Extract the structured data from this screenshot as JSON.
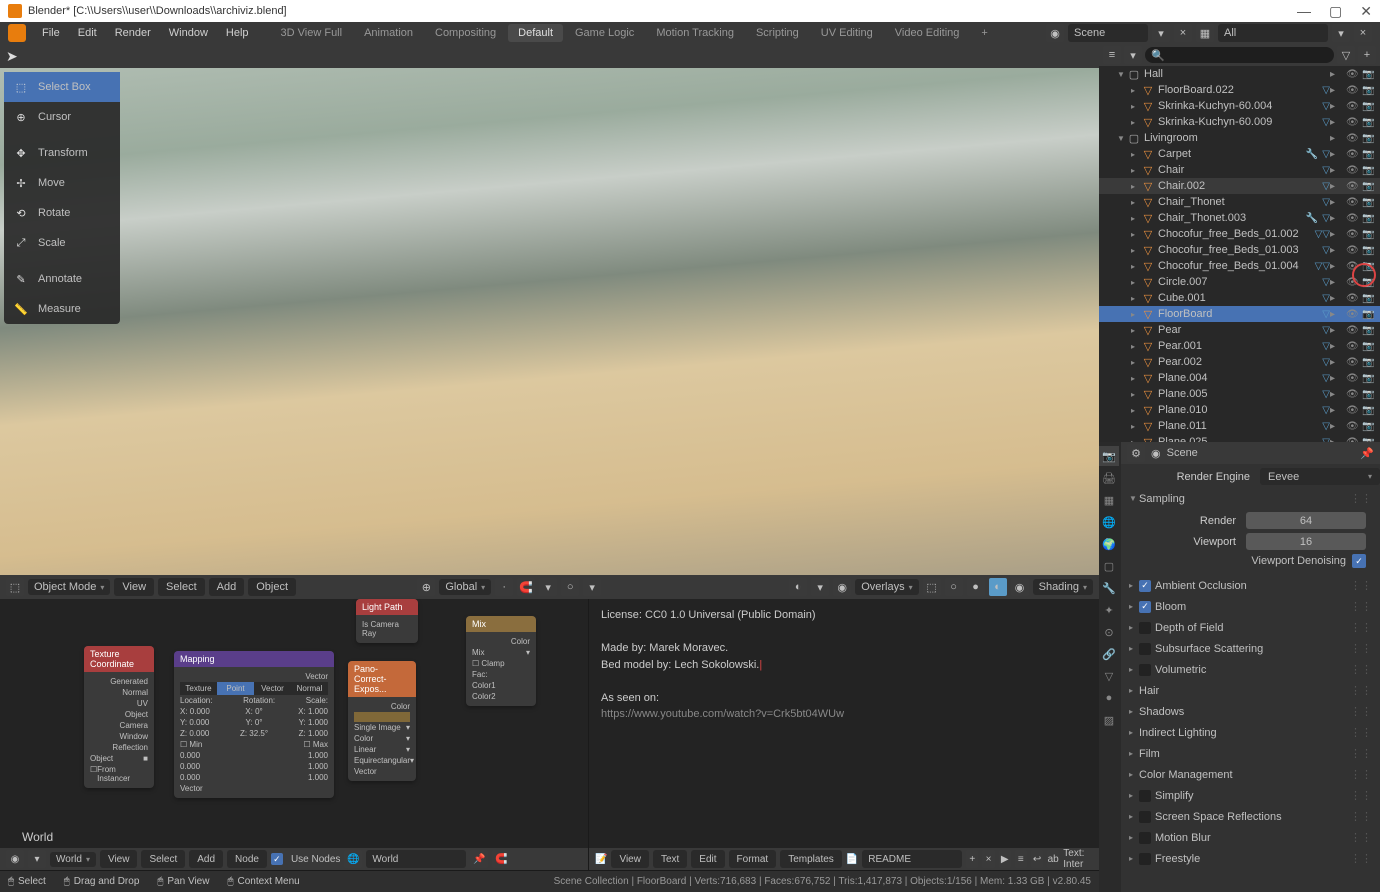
{
  "titlebar": {
    "title": "Blender* [C:\\\\Users\\\\user\\\\Downloads\\\\archiviz.blend]"
  },
  "menubar": {
    "items": [
      "File",
      "Edit",
      "Render",
      "Window",
      "Help"
    ],
    "workspaces": [
      "3D View Full",
      "Animation",
      "Compositing",
      "Default",
      "Game Logic",
      "Motion Tracking",
      "Scripting",
      "UV Editing",
      "Video Editing"
    ],
    "active_workspace": "Default",
    "scene": "Scene",
    "layers": "All"
  },
  "tools": [
    {
      "label": "Select Box",
      "active": true,
      "icon": "⬚"
    },
    {
      "label": "Cursor",
      "icon": "⊕"
    },
    {
      "label": "Transform",
      "icon": "✥",
      "sep_before": true
    },
    {
      "label": "Move",
      "icon": "✢"
    },
    {
      "label": "Rotate",
      "icon": "⟲"
    },
    {
      "label": "Scale",
      "icon": "⤢"
    },
    {
      "label": "Annotate",
      "icon": "✎",
      "sep_before": true
    },
    {
      "label": "Measure",
      "icon": "📏"
    }
  ],
  "viewport_header": {
    "mode": "Object Mode",
    "menus": [
      "View",
      "Select",
      "Add",
      "Object"
    ],
    "orientation": "Global",
    "shading": "Shading",
    "overlays": "Overlays"
  },
  "node_editor": {
    "world_label": "World",
    "nodes": {
      "tex_coord": {
        "title": "Texture Coordinate",
        "outputs": [
          "Generated",
          "Normal",
          "UV",
          "Object",
          "Camera",
          "Window",
          "Reflection"
        ],
        "object": "Object",
        "from": "From Instancer"
      },
      "mapping": {
        "title": "Mapping",
        "tabs": [
          "Texture",
          "Point",
          "Vector",
          "Normal"
        ],
        "loc": "Location:",
        "rot": "Rotation:",
        "scale": "Scale:",
        "x": "X:",
        "y": "Y:",
        "z": "Z:",
        "v0": "0.000",
        "v1": "1.000",
        "deg0": "0°",
        "deg32": "32.5°",
        "min": "Min",
        "max": "Max",
        "vector": "Vector"
      },
      "light_path": {
        "title": "Light Path",
        "row": "Is Camera Ray"
      },
      "pano": {
        "title": "Pano-Correct-Expos...",
        "color": "Color",
        "single": "Single Image",
        "linear": "Linear",
        "equirect": "Equirectangular",
        "vector": "Vector"
      },
      "mix": {
        "title": "Mix",
        "color": "Color",
        "mode": "Mix",
        "clamp": "Clamp",
        "fac": "Fac:",
        "c1": "Color1",
        "c2": "Color2"
      }
    },
    "header": {
      "menus": [
        "View",
        "Select",
        "Add",
        "Node"
      ],
      "use_nodes": "Use Nodes",
      "world": "World"
    }
  },
  "text_editor": {
    "lines": [
      "License: CC0 1.0 Universal (Public Domain)",
      "",
      "Made by: Marek Moravec.",
      "Bed model by: Lech Sokolowski.",
      "",
      "As seen on:",
      "https://www.youtube.com/watch?v=Crk5bt04WUw"
    ],
    "header": {
      "menus": [
        "View",
        "Text",
        "Edit",
        "Format",
        "Templates"
      ],
      "filename": "README",
      "text_label": "Text: Inter"
    }
  },
  "outliner": {
    "collections": [
      {
        "name": "Hall",
        "depth": 1,
        "expanded": true,
        "type": "collection"
      },
      {
        "name": "FloorBoard.022",
        "depth": 2,
        "type": "mesh",
        "mod": true
      },
      {
        "name": "Skrinka-Kuchyn-60.004",
        "depth": 2,
        "type": "mesh",
        "mod": true
      },
      {
        "name": "Skrinka-Kuchyn-60.009",
        "depth": 2,
        "type": "mesh",
        "mod": true
      },
      {
        "name": "Livingroom",
        "depth": 1,
        "expanded": true,
        "type": "collection"
      },
      {
        "name": "Carpet",
        "depth": 2,
        "type": "mesh",
        "wrench": true,
        "mod": true
      },
      {
        "name": "Chair",
        "depth": 2,
        "type": "mesh",
        "mod": true
      },
      {
        "name": "Chair.002",
        "depth": 2,
        "type": "mesh",
        "mod": true,
        "selected": true
      },
      {
        "name": "Chair_Thonet",
        "depth": 2,
        "type": "mesh",
        "mod": true
      },
      {
        "name": "Chair_Thonet.003",
        "depth": 2,
        "type": "mesh",
        "wrench": true,
        "mod": true
      },
      {
        "name": "Chocofur_free_Beds_01.002",
        "depth": 2,
        "type": "mesh",
        "mod2": true
      },
      {
        "name": "Chocofur_free_Beds_01.003",
        "depth": 2,
        "type": "mesh",
        "mod": true
      },
      {
        "name": "Chocofur_free_Beds_01.004",
        "depth": 2,
        "type": "mesh",
        "mod2": true
      },
      {
        "name": "Circle.007",
        "depth": 2,
        "type": "mesh",
        "mod": true
      },
      {
        "name": "Cube.001",
        "depth": 2,
        "type": "mesh",
        "mod": true
      },
      {
        "name": "FloorBoard",
        "depth": 2,
        "type": "mesh",
        "mod": true,
        "active": true
      },
      {
        "name": "Pear",
        "depth": 2,
        "type": "mesh",
        "mod": true
      },
      {
        "name": "Pear.001",
        "depth": 2,
        "type": "mesh",
        "mod": true
      },
      {
        "name": "Pear.002",
        "depth": 2,
        "type": "mesh",
        "mod": true
      },
      {
        "name": "Plane.004",
        "depth": 2,
        "type": "mesh",
        "mod": true
      },
      {
        "name": "Plane.005",
        "depth": 2,
        "type": "mesh",
        "mod": true
      },
      {
        "name": "Plane.010",
        "depth": 2,
        "type": "mesh",
        "mod": true
      },
      {
        "name": "Plane.011",
        "depth": 2,
        "type": "mesh",
        "mod": true
      },
      {
        "name": "Plane.025",
        "depth": 2,
        "type": "mesh",
        "mod": true
      }
    ]
  },
  "properties": {
    "header": "Scene",
    "render_engine_label": "Render Engine",
    "render_engine": "Eevee",
    "sampling": {
      "title": "Sampling",
      "render_label": "Render",
      "render": "64",
      "viewport_label": "Viewport",
      "viewport": "16",
      "denoise_label": "Viewport Denoising"
    },
    "panels": [
      {
        "label": "Ambient Occlusion",
        "checked": true
      },
      {
        "label": "Bloom",
        "checked": true
      },
      {
        "label": "Depth of Field"
      },
      {
        "label": "Subsurface Scattering"
      },
      {
        "label": "Volumetric"
      },
      {
        "label": "Hair"
      },
      {
        "label": "Shadows"
      },
      {
        "label": "Indirect Lighting"
      },
      {
        "label": "Film"
      },
      {
        "label": "Color Management"
      },
      {
        "label": "Simplify"
      },
      {
        "label": "Screen Space Reflections"
      },
      {
        "label": "Motion Blur"
      },
      {
        "label": "Freestyle"
      }
    ]
  },
  "statusbar": {
    "select": "Select",
    "drag": "Drag and Drop",
    "pan": "Pan View",
    "context": "Context Menu",
    "info": "Scene Collection | FloorBoard | Verts:716,683 | Faces:676,752 | Tris:1,417,873 | Objects:1/156 | Mem: 1.33 GB | v2.80.45"
  }
}
